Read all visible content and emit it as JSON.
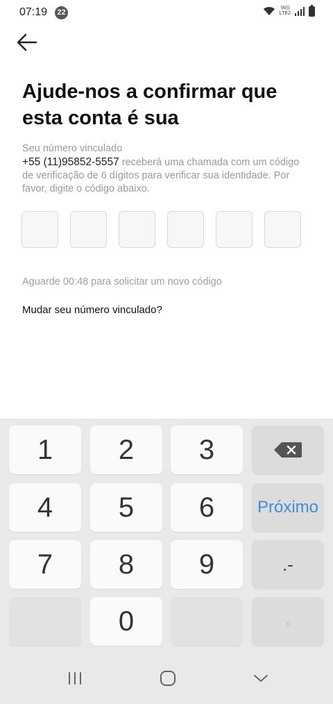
{
  "status_bar": {
    "time": "07:19",
    "notification_count": "22",
    "network_label_top": "Vo))",
    "network_label_bottom": "LTE2"
  },
  "header": {
    "back_icon": "arrow-left-icon",
    "title": "Ajude-nos a confirmar que esta conta é sua"
  },
  "description": {
    "line1": "Seu número vinculado",
    "phone": "+55 (11)95852-5557",
    "rest": " receberá uma chamada com um código de verificação de 6 dígitos para verificar sua identidade. Por favor, digite o código abaixo."
  },
  "code_inputs": [
    "",
    "",
    "",
    "",
    "",
    ""
  ],
  "timer_text": "Aguarde 00:48 para solicitar um novo código",
  "change_number_link": "Mudar seu número vinculado?",
  "keyboard": {
    "keys": {
      "k1": "1",
      "k2": "2",
      "k3": "3",
      "k4": "4",
      "k5": "5",
      "k6": "6",
      "k7": "7",
      "k8": "8",
      "k9": "9",
      "k0": "0",
      "next": "Próximo",
      "dot_dash": ".-",
      "comma": ","
    },
    "accent_color": "#3d8fd6"
  },
  "nav_bar": {
    "recent_icon": "recent-apps-icon",
    "home_icon": "home-icon",
    "back_icon": "chevron-down-icon"
  }
}
